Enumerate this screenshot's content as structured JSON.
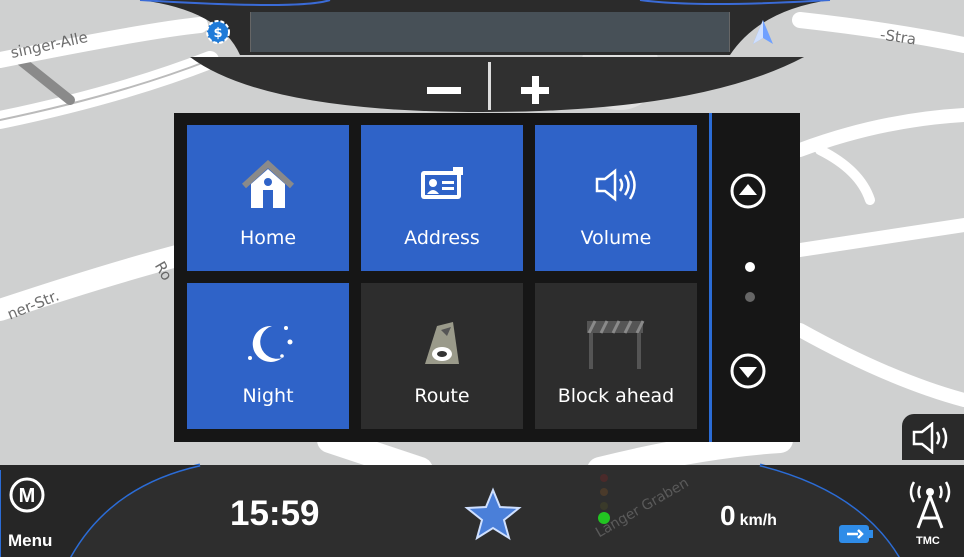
{
  "map": {
    "street_labels": [
      "singer-Alle",
      "r-Str.",
      "-Stra",
      "ner-Str.",
      "Ro",
      "Langer Graben"
    ]
  },
  "topbar": {
    "speedcam_icon": "speed-camera-icon",
    "street_text": "",
    "compass_icon": "north-arrow-icon"
  },
  "zoom": {
    "minus_icon": "minus-icon",
    "plus_icon": "plus-icon"
  },
  "quick_menu": {
    "tiles": [
      {
        "label": "Home",
        "icon": "home-icon",
        "style": "blue"
      },
      {
        "label": "Address",
        "icon": "address-card-icon",
        "style": "blue"
      },
      {
        "label": "Volume",
        "icon": "speaker-icon",
        "style": "blue"
      },
      {
        "label": "Night",
        "icon": "moon-stars-icon",
        "style": "blue"
      },
      {
        "label": "Route",
        "icon": "route-icon",
        "style": "dark"
      },
      {
        "label": "Block ahead",
        "icon": "roadblock-icon",
        "style": "dark"
      }
    ],
    "page_index": 1,
    "page_count": 2
  },
  "bottombar": {
    "menu_label": "Menu",
    "menu_icon_letter": "M",
    "time": "15:59",
    "speed_value": "0",
    "speed_unit": "km/h",
    "tmc_label": "TMC"
  },
  "colors": {
    "accent_blue": "#2f63c8",
    "divider_blue": "#2b6cd6",
    "bar_dark": "#2e2e2e",
    "gps_green": "#22c422"
  }
}
